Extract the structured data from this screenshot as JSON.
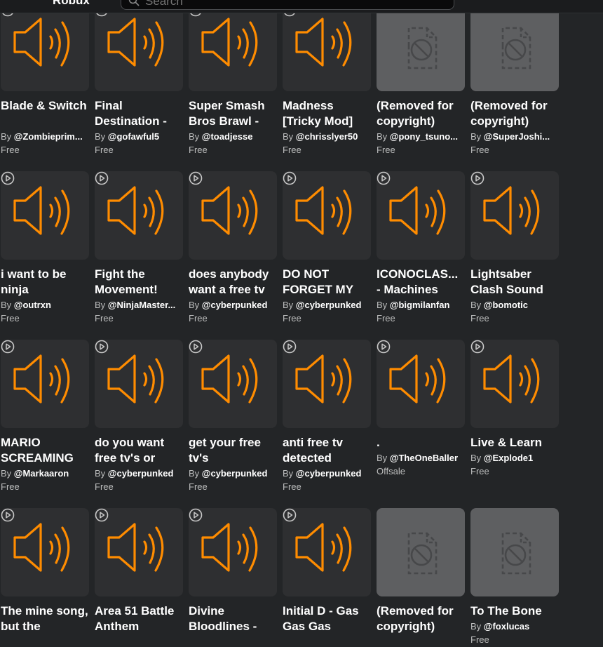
{
  "header": {
    "robux_label": "Robux",
    "search_placeholder": "Search"
  },
  "colors": {
    "accent": "#ff8c00",
    "background": "#232527",
    "thumb": "#2e2f31",
    "removed_thumb": "#5e5f61"
  },
  "by_prefix": "By",
  "items": [
    {
      "title": "Blade & Switch",
      "creator": "@Zombieprim...",
      "price": "Free",
      "thumb": "audio"
    },
    {
      "title": "Final Destination -",
      "creator": "@gofawful5",
      "price": "Free",
      "thumb": "audio"
    },
    {
      "title": "Super Smash Bros Brawl -",
      "creator": "@toadjesse",
      "price": "Free",
      "thumb": "audio"
    },
    {
      "title": "Madness [Tricky Mod]",
      "creator": "@chrisslyer50",
      "price": "Free",
      "thumb": "audio"
    },
    {
      "title": "(Removed for copyright)",
      "creator": "@pony_tsuno...",
      "price": "Free",
      "thumb": "removed"
    },
    {
      "title": "(Removed for copyright)",
      "creator": "@SuperJoshi...",
      "price": "Free",
      "thumb": "removed"
    },
    {
      "title": "i want to be ninja",
      "creator": "@outrxn",
      "price": "Free",
      "thumb": "audio"
    },
    {
      "title": "Fight the Movement!",
      "creator": "@NinjaMaster...",
      "price": "Free",
      "thumb": "audio"
    },
    {
      "title": "does anybody want a free tv",
      "creator": "@cyberpunked",
      "price": "Free",
      "thumb": "audio"
    },
    {
      "title": "DO NOT FORGET MY",
      "creator": "@cyberpunked",
      "price": "Free",
      "thumb": "audio"
    },
    {
      "title": "ICONOCLAS... - Machines",
      "creator": "@bigmilanfan",
      "price": "Free",
      "thumb": "audio"
    },
    {
      "title": "Lightsaber Clash Sound",
      "creator": "@bomotic",
      "price": "Free",
      "thumb": "audio"
    },
    {
      "title": "MARIO SCREAMING",
      "creator": "@Markaaron",
      "price": "Free",
      "thumb": "audio"
    },
    {
      "title": "do you want free tv's or",
      "creator": "@cyberpunked",
      "price": "Free",
      "thumb": "audio"
    },
    {
      "title": "get your free tv's",
      "creator": "@cyberpunked",
      "price": "Free",
      "thumb": "audio"
    },
    {
      "title": "anti free tv detected",
      "creator": "@cyberpunked",
      "price": "Free",
      "thumb": "audio"
    },
    {
      "title": ".",
      "creator": "@TheOneBaller",
      "price": "Offsale",
      "thumb": "audio",
      "single_line": true
    },
    {
      "title": "Live & Learn",
      "creator": "@Explode1",
      "price": "Free",
      "thumb": "audio",
      "single_line": true
    },
    {
      "title": "The mine song, but the",
      "thumb": "audio"
    },
    {
      "title": "Area 51 Battle Anthem",
      "thumb": "audio"
    },
    {
      "title": "Divine Bloodlines -",
      "thumb": "audio"
    },
    {
      "title": "Initial D - Gas Gas Gas",
      "thumb": "audio"
    },
    {
      "title": "(Removed for copyright)",
      "thumb": "removed"
    },
    {
      "title": "To The Bone",
      "creator": "@foxlucas",
      "price": "Free",
      "thumb": "removed",
      "single_line": true
    }
  ]
}
